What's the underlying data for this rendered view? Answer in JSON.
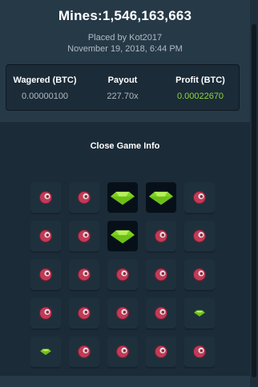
{
  "game": {
    "title": "Mines:1,546,163,663",
    "placed_by": "Placed by Kot2017",
    "date": "November 19, 2018, 6:44 PM"
  },
  "stats": {
    "wagered_label": "Wagered (BTC)",
    "wagered_value": "0.00000100",
    "payout_label": "Payout",
    "payout_value": "227.70x",
    "profit_label": "Profit (BTC)",
    "profit_value": "0.00022670"
  },
  "close_label": "Close Game Info",
  "colors": {
    "gem": "#7ed321",
    "profit": "#8ed63a",
    "mine": "#c23a56"
  },
  "board": {
    "rows": 5,
    "cols": 5,
    "tiles": [
      "mine",
      "mine",
      "gem-revealed",
      "gem-revealed",
      "mine",
      "mine",
      "mine",
      "gem-revealed",
      "mine",
      "mine",
      "mine",
      "mine",
      "mine",
      "mine",
      "mine",
      "mine",
      "mine",
      "mine",
      "mine",
      "gem",
      "gem",
      "mine",
      "mine",
      "mine",
      "mine"
    ]
  }
}
